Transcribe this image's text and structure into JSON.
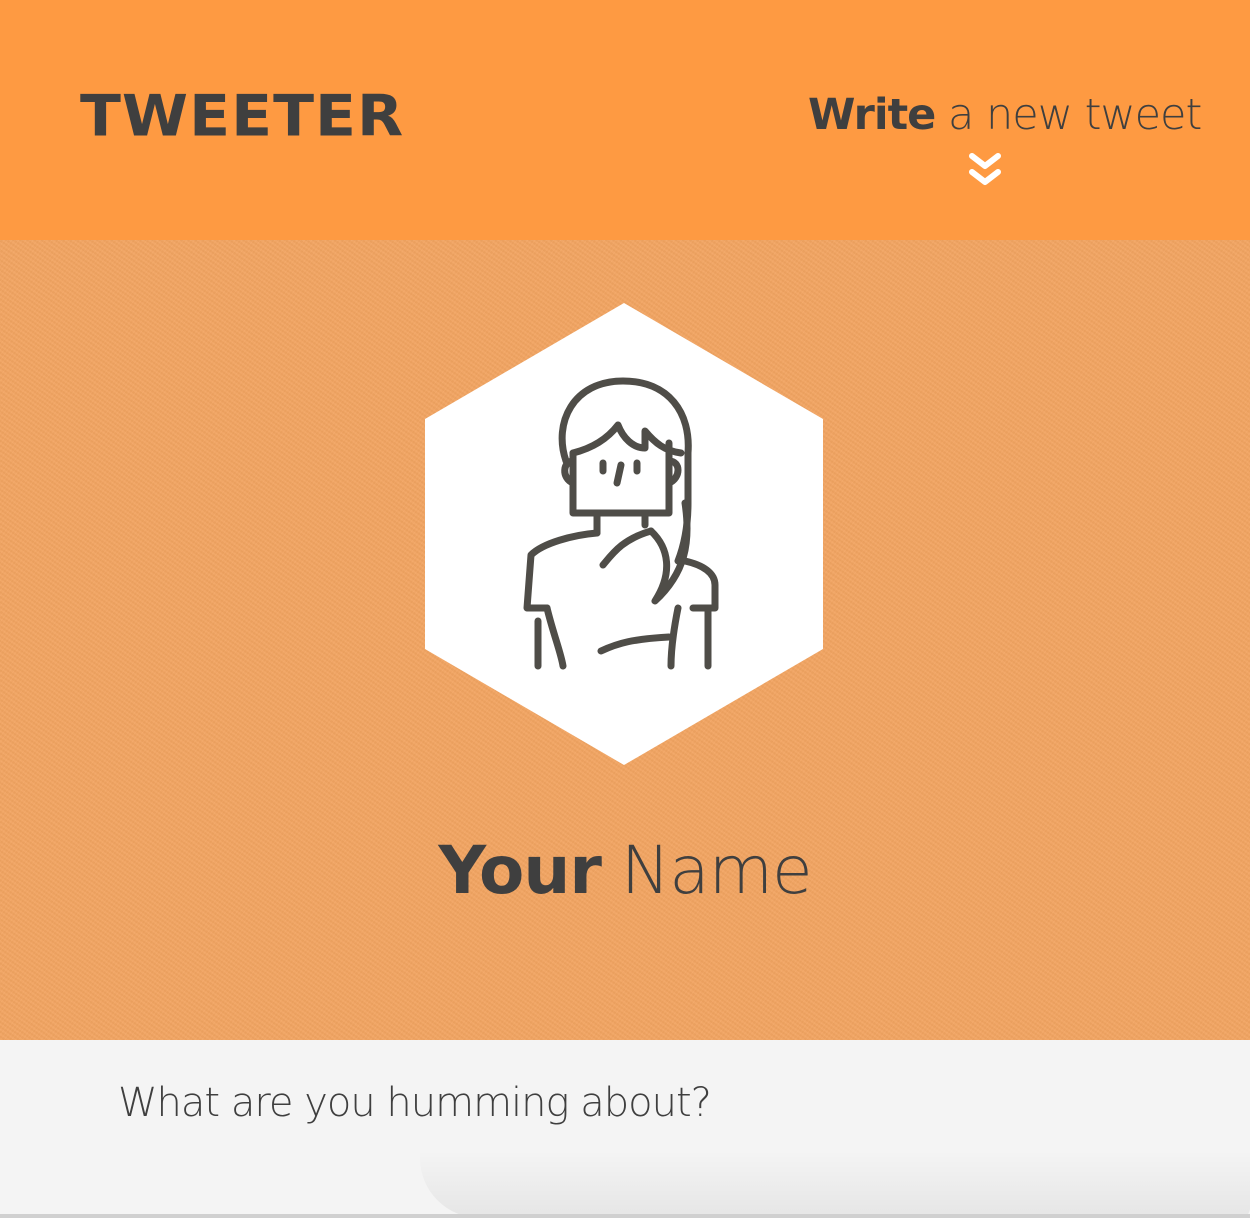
{
  "navbar": {
    "logo": "TWEETER",
    "compose_toggle": {
      "label_strong": "Write",
      "label_rest": " a new tweet",
      "icon": "double-chevron-down-icon"
    }
  },
  "profile": {
    "avatar_icon": "woman-avatar-icon",
    "name_first": "Your",
    "name_rest": " Name"
  },
  "composer": {
    "placeholder": "What are you humming about?"
  },
  "colors": {
    "navbar_bg": "#fe9a42",
    "hero_bg": "#f3a562",
    "text": "#3f3f3f",
    "composer_bg": "#f4f4f4"
  }
}
